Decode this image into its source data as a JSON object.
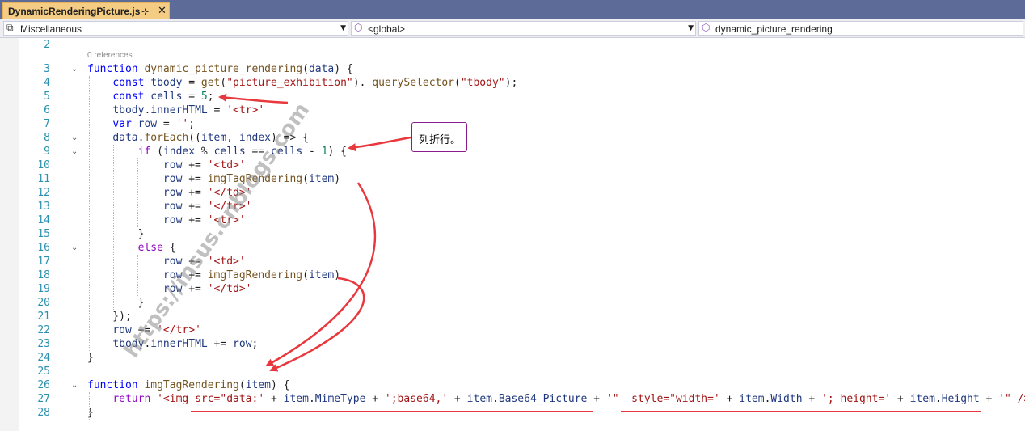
{
  "tab": {
    "title": "DynamicRenderingPicture.js",
    "pin": "⊹",
    "close": "✕"
  },
  "navbar": {
    "project": "Miscellaneous",
    "scope": "<global>",
    "member": "dynamic_picture_rendering"
  },
  "codelens": "0 references",
  "callout": "列折行。",
  "watermark": "https://insus.cnblogs.com",
  "colors": {
    "tab_bg": "#f5cc84",
    "tabstrip_bg": "#5d6b99",
    "annotation": "#e8383d",
    "line_number": "#2b91af"
  },
  "lines": [
    {
      "n": "2",
      "fold": "",
      "tokens": []
    },
    {
      "n": "3",
      "fold": "⌄",
      "tokens": [
        [
          "kw",
          "function "
        ],
        [
          "fn",
          "dynamic_picture_rendering"
        ],
        [
          "",
          "("
        ],
        [
          "var",
          "data"
        ],
        [
          "",
          ") {"
        ]
      ]
    },
    {
      "n": "4",
      "fold": "",
      "tokens": [
        [
          "",
          "    "
        ],
        [
          "kw",
          "const "
        ],
        [
          "var",
          "tbody"
        ],
        [
          "",
          " = "
        ],
        [
          "fn",
          "get"
        ],
        [
          "",
          "("
        ],
        [
          "str",
          "\"picture_exhibition\""
        ],
        [
          "",
          "). "
        ],
        [
          "fn",
          "querySelector"
        ],
        [
          "",
          "("
        ],
        [
          "str",
          "\"tbody\""
        ],
        [
          "",
          ");"
        ]
      ]
    },
    {
      "n": "5",
      "fold": "",
      "tokens": [
        [
          "",
          "    "
        ],
        [
          "kw",
          "const "
        ],
        [
          "var",
          "cells"
        ],
        [
          "",
          " = "
        ],
        [
          "num",
          "5"
        ],
        [
          "",
          ";"
        ]
      ]
    },
    {
      "n": "6",
      "fold": "",
      "tokens": [
        [
          "",
          "    "
        ],
        [
          "var",
          "tbody"
        ],
        [
          "",
          "."
        ],
        [
          "var",
          "innerHTML"
        ],
        [
          "",
          " = "
        ],
        [
          "str",
          "'<tr>'"
        ]
      ]
    },
    {
      "n": "7",
      "fold": "",
      "tokens": [
        [
          "",
          "    "
        ],
        [
          "kw",
          "var "
        ],
        [
          "var",
          "row"
        ],
        [
          "",
          " = "
        ],
        [
          "str",
          "''"
        ],
        [
          "",
          ";"
        ]
      ]
    },
    {
      "n": "8",
      "fold": "⌄",
      "tokens": [
        [
          "",
          "    "
        ],
        [
          "var",
          "data"
        ],
        [
          "",
          "."
        ],
        [
          "fn",
          "forEach"
        ],
        [
          "",
          "(("
        ],
        [
          "var",
          "item"
        ],
        [
          "",
          ", "
        ],
        [
          "var",
          "index"
        ],
        [
          "",
          ") => {"
        ]
      ]
    },
    {
      "n": "9",
      "fold": "⌄",
      "tokens": [
        [
          "",
          "        "
        ],
        [
          "kwc",
          "if "
        ],
        [
          "",
          "("
        ],
        [
          "var",
          "index"
        ],
        [
          "",
          " % "
        ],
        [
          "var",
          "cells"
        ],
        [
          "",
          " == "
        ],
        [
          "var",
          "cells"
        ],
        [
          "",
          " - "
        ],
        [
          "num",
          "1"
        ],
        [
          "",
          ") {"
        ]
      ]
    },
    {
      "n": "10",
      "fold": "",
      "tokens": [
        [
          "",
          "            "
        ],
        [
          "var",
          "row"
        ],
        [
          "",
          " += "
        ],
        [
          "str",
          "'<td>'"
        ]
      ]
    },
    {
      "n": "11",
      "fold": "",
      "tokens": [
        [
          "",
          "            "
        ],
        [
          "var",
          "row"
        ],
        [
          "",
          " += "
        ],
        [
          "fn",
          "imgTagRendering"
        ],
        [
          "",
          "("
        ],
        [
          "var",
          "item"
        ],
        [
          "",
          ")"
        ]
      ]
    },
    {
      "n": "12",
      "fold": "",
      "tokens": [
        [
          "",
          "            "
        ],
        [
          "var",
          "row"
        ],
        [
          "",
          " += "
        ],
        [
          "str",
          "'</td>'"
        ]
      ]
    },
    {
      "n": "13",
      "fold": "",
      "tokens": [
        [
          "",
          "            "
        ],
        [
          "var",
          "row"
        ],
        [
          "",
          " += "
        ],
        [
          "str",
          "'</tr>'"
        ]
      ]
    },
    {
      "n": "14",
      "fold": "",
      "tokens": [
        [
          "",
          "            "
        ],
        [
          "var",
          "row"
        ],
        [
          "",
          " += "
        ],
        [
          "str",
          "'<tr>'"
        ]
      ]
    },
    {
      "n": "15",
      "fold": "",
      "tokens": [
        [
          "",
          "        }"
        ]
      ]
    },
    {
      "n": "16",
      "fold": "⌄",
      "tokens": [
        [
          "",
          "        "
        ],
        [
          "kwc",
          "else "
        ],
        [
          "",
          "{"
        ]
      ]
    },
    {
      "n": "17",
      "fold": "",
      "tokens": [
        [
          "",
          "            "
        ],
        [
          "var",
          "row"
        ],
        [
          "",
          " += "
        ],
        [
          "str",
          "'<td>'"
        ]
      ]
    },
    {
      "n": "18",
      "fold": "",
      "tokens": [
        [
          "",
          "            "
        ],
        [
          "var",
          "row"
        ],
        [
          "",
          " += "
        ],
        [
          "fn",
          "imgTagRendering"
        ],
        [
          "",
          "("
        ],
        [
          "var",
          "item"
        ],
        [
          "",
          ")"
        ]
      ]
    },
    {
      "n": "19",
      "fold": "",
      "tokens": [
        [
          "",
          "            "
        ],
        [
          "var",
          "row"
        ],
        [
          "",
          " += "
        ],
        [
          "str",
          "'</td>'"
        ]
      ]
    },
    {
      "n": "20",
      "fold": "",
      "tokens": [
        [
          "",
          "        }"
        ]
      ]
    },
    {
      "n": "21",
      "fold": "",
      "tokens": [
        [
          "",
          "    });"
        ]
      ]
    },
    {
      "n": "22",
      "fold": "",
      "tokens": [
        [
          "",
          "    "
        ],
        [
          "var",
          "row"
        ],
        [
          "",
          " += "
        ],
        [
          "str",
          "'</tr>'"
        ]
      ]
    },
    {
      "n": "23",
      "fold": "",
      "tokens": [
        [
          "",
          "    "
        ],
        [
          "var",
          "tbody"
        ],
        [
          "",
          "."
        ],
        [
          "var",
          "innerHTML"
        ],
        [
          "",
          " += "
        ],
        [
          "var",
          "row"
        ],
        [
          "",
          ";"
        ]
      ]
    },
    {
      "n": "24",
      "fold": "",
      "tokens": [
        [
          "",
          "}"
        ]
      ]
    },
    {
      "n": "25",
      "fold": "",
      "tokens": []
    },
    {
      "n": "26",
      "fold": "⌄",
      "tokens": [
        [
          "kw",
          "function "
        ],
        [
          "fn",
          "imgTagRendering"
        ],
        [
          "",
          "("
        ],
        [
          "var",
          "item"
        ],
        [
          "",
          ") {"
        ]
      ]
    },
    {
      "n": "27",
      "fold": "",
      "tokens": [
        [
          "",
          "    "
        ],
        [
          "kwc",
          "return "
        ],
        [
          "str",
          "'<img src=\"data:'"
        ],
        [
          "",
          " + "
        ],
        [
          "var",
          "item"
        ],
        [
          "",
          "."
        ],
        [
          "var",
          "MimeType"
        ],
        [
          "",
          " + "
        ],
        [
          "str",
          "';base64,'"
        ],
        [
          "",
          " + "
        ],
        [
          "var",
          "item"
        ],
        [
          "",
          "."
        ],
        [
          "var",
          "Base64_Picture"
        ],
        [
          "",
          " + "
        ],
        [
          "str",
          "'\"  style=\"width='"
        ],
        [
          "",
          " + "
        ],
        [
          "var",
          "item"
        ],
        [
          "",
          "."
        ],
        [
          "var",
          "Width"
        ],
        [
          "",
          " + "
        ],
        [
          "str",
          "'; height='"
        ],
        [
          "",
          " + "
        ],
        [
          "var",
          "item"
        ],
        [
          "",
          "."
        ],
        [
          "var",
          "Height"
        ],
        [
          "",
          " + "
        ],
        [
          "str",
          "'\" />'"
        ],
        [
          "",
          ";"
        ]
      ]
    },
    {
      "n": "28",
      "fold": "",
      "tokens": [
        [
          "",
          "}"
        ]
      ]
    }
  ]
}
